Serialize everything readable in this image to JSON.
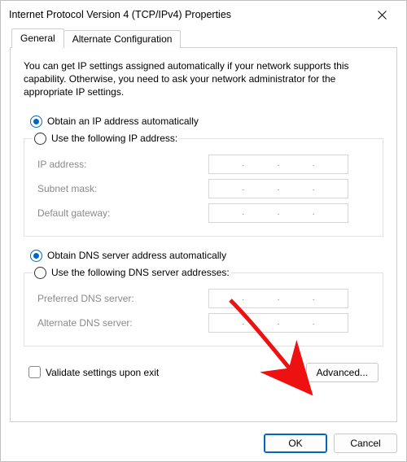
{
  "window": {
    "title": "Internet Protocol Version 4 (TCP/IPv4) Properties"
  },
  "tabs": {
    "general": "General",
    "alternate": "Alternate Configuration"
  },
  "intro": "You can get IP settings assigned automatically if your network supports this capability. Otherwise, you need to ask your network administrator for the appropriate IP settings.",
  "ip": {
    "auto": "Obtain an IP address automatically",
    "manual": "Use the following IP address:",
    "addr": "IP address:",
    "mask": "Subnet mask:",
    "gateway": "Default gateway:"
  },
  "dns": {
    "auto": "Obtain DNS server address automatically",
    "manual": "Use the following DNS server addresses:",
    "preferred": "Preferred DNS server:",
    "alternate": "Alternate DNS server:"
  },
  "validate": "Validate settings upon exit",
  "buttons": {
    "advanced": "Advanced...",
    "ok": "OK",
    "cancel": "Cancel"
  }
}
